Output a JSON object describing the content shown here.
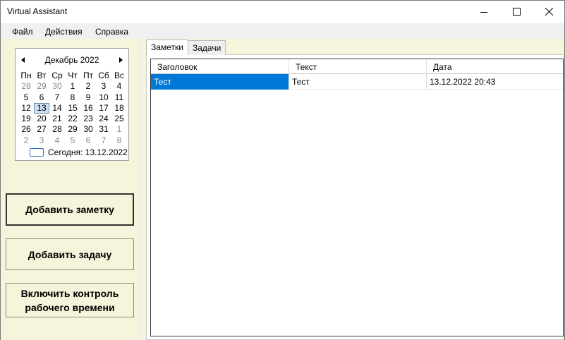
{
  "window": {
    "title": "Virtual Assistant"
  },
  "menu": {
    "items": [
      "Файл",
      "Действия",
      "Справка"
    ]
  },
  "calendar": {
    "month_label": "Декабрь 2022",
    "weekdays": [
      "Пн",
      "Вт",
      "Ср",
      "Чт",
      "Пт",
      "Сб",
      "Вс"
    ],
    "weeks": [
      [
        "28",
        "29",
        "30",
        "1",
        "2",
        "3",
        "4"
      ],
      [
        "5",
        "6",
        "7",
        "8",
        "9",
        "10",
        "11"
      ],
      [
        "12",
        "13",
        "14",
        "15",
        "16",
        "17",
        "18"
      ],
      [
        "19",
        "20",
        "21",
        "22",
        "23",
        "24",
        "25"
      ],
      [
        "26",
        "27",
        "28",
        "29",
        "30",
        "31",
        "1"
      ],
      [
        "2",
        "3",
        "4",
        "5",
        "6",
        "7",
        "8"
      ]
    ],
    "selected_day": "13",
    "today_label": "Сегодня: 13.12.2022"
  },
  "buttons": {
    "add_note": "Добавить заметку",
    "add_task": "Добавить задачу",
    "work_time_line1": "Включить контроль",
    "work_time_line2": "рабочего времени"
  },
  "tabs": {
    "notes": "Заметки",
    "tasks": "Задачи",
    "active": "notes"
  },
  "notes_table": {
    "columns": [
      "Заголовок",
      "Текст",
      "Дата"
    ],
    "rows": [
      [
        "Тест",
        "Тест",
        "13.12.2022 20:43"
      ]
    ]
  },
  "colors": {
    "pane_background": "#f5f5dc",
    "selection": "#0078d7"
  },
  "icons": {
    "minimize": "minimize-icon",
    "maximize": "maximize-icon",
    "close": "close-icon",
    "prev_month": "chevron-left-icon",
    "next_month": "chevron-right-icon"
  }
}
